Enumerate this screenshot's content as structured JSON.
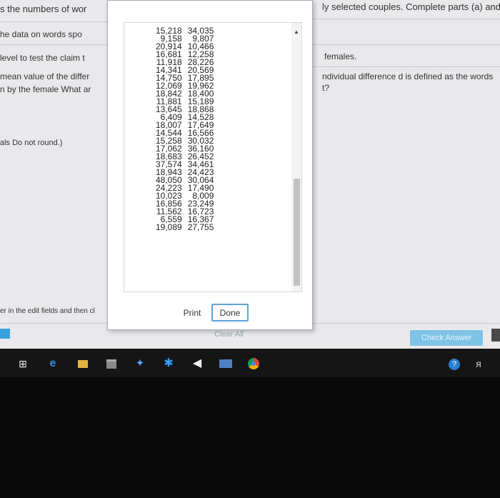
{
  "page": {
    "left_lines": [
      "s the numbers of wor",
      "he data on words spo",
      "level to test the claim t",
      "mean value of the differ",
      "n by the female  What ar",
      "als  Do not round.)",
      "er in the edit fields and then cl"
    ],
    "right_lines": [
      "ly selected couples. Complete parts (a) and",
      "females.",
      "ndividual difference d is defined as the words",
      "t?"
    ],
    "clear_all": "Clear All",
    "check_answer": "Check Answer"
  },
  "dialog": {
    "rows": [
      [
        "15,218",
        "34,035"
      ],
      [
        "9,158",
        "9,807"
      ],
      [
        "20,914",
        "10,466"
      ],
      [
        "16,681",
        "12,258"
      ],
      [
        "11,918",
        "28,226"
      ],
      [
        "14,341",
        "20,569"
      ],
      [
        "14,750",
        "17,895"
      ],
      [
        "12,069",
        "19,962"
      ],
      [
        "18,842",
        "18,400"
      ],
      [
        "11,881",
        "15,189"
      ],
      [
        "13,645",
        "18,868"
      ],
      [
        "6,409",
        "14,528"
      ],
      [
        "18,007",
        "17,649"
      ],
      [
        "14,544",
        "16,566"
      ],
      [
        "15,258",
        "30,032"
      ],
      [
        "17,062",
        "36,160"
      ],
      [
        "18,683",
        "26,452"
      ],
      [
        "37,574",
        "34,461"
      ],
      [
        "18,943",
        "24,423"
      ],
      [
        "48,050",
        "30,064"
      ],
      [
        "24,223",
        "17,490"
      ],
      [
        "10,023",
        "8,009"
      ],
      [
        "16,856",
        "23,249"
      ],
      [
        "11,562",
        "16,723"
      ],
      [
        "6,559",
        "16,367"
      ],
      [
        "19,089",
        "27,755"
      ]
    ],
    "print_label": "Print",
    "done_label": "Done"
  },
  "taskbar": {
    "icons": [
      "task-view-icon",
      "edge-icon",
      "file-explorer-icon",
      "store-icon",
      "dropbox-icon",
      "sway-icon",
      "mail-icon",
      "photos-icon",
      "chrome-icon",
      "help-icon",
      "people-icon"
    ]
  }
}
